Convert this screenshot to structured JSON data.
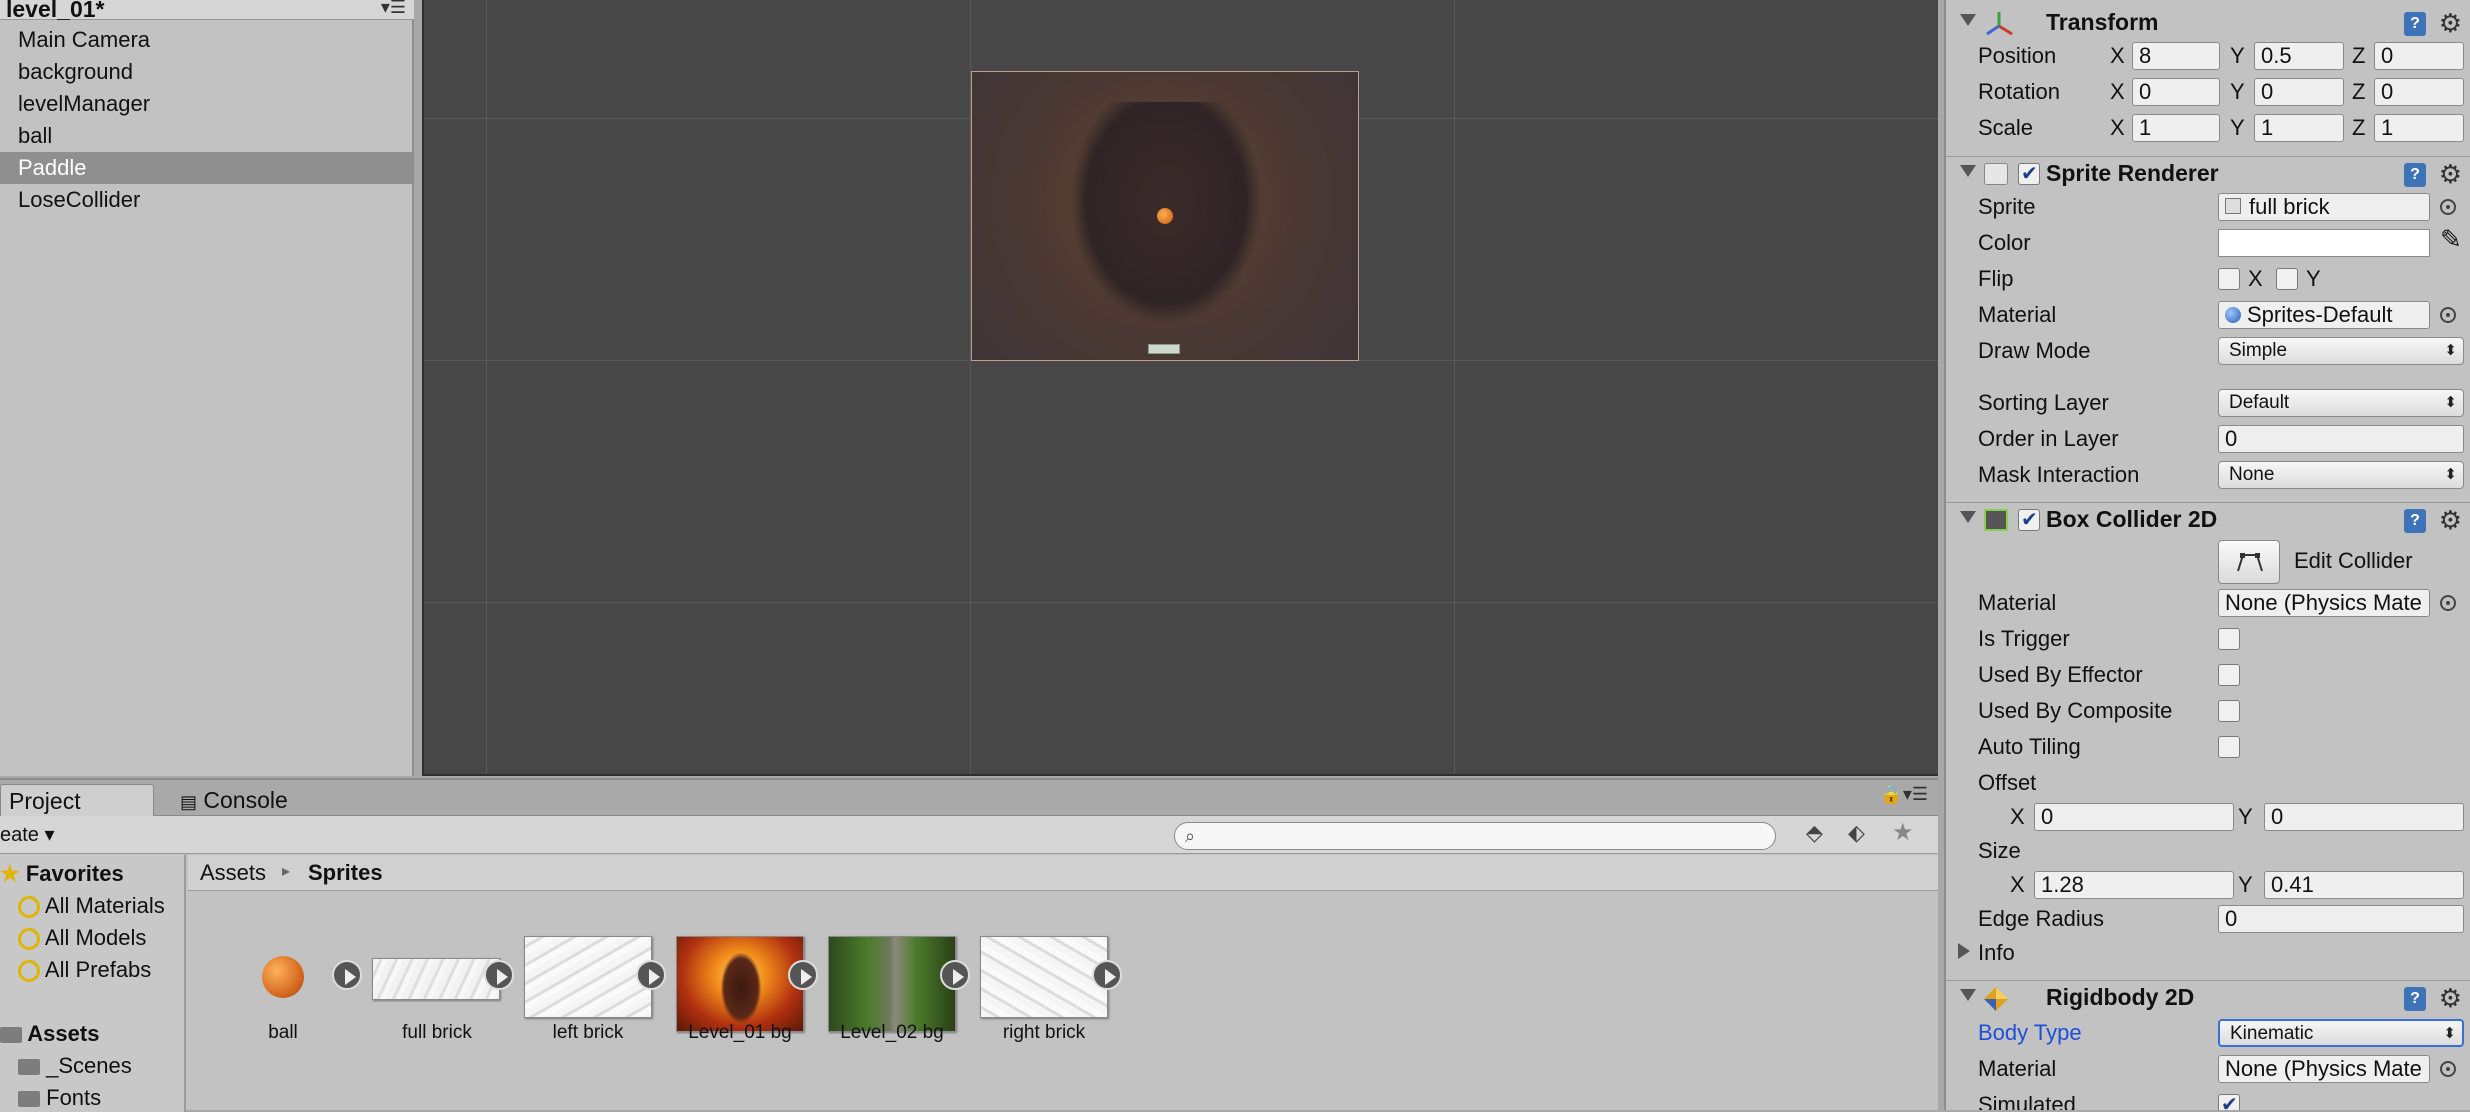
{
  "hierarchy": {
    "scene_name": "level_01*",
    "items": [
      "Main Camera",
      "background",
      "levelManager",
      "ball",
      "Paddle",
      "LoseCollider"
    ],
    "selected": "Paddle"
  },
  "inspector": {
    "transform": {
      "title": "Transform",
      "position_label": "Position",
      "position": {
        "x": "8",
        "y": "0.5",
        "z": "0"
      },
      "rotation_label": "Rotation",
      "rotation": {
        "x": "0",
        "y": "0",
        "z": "0"
      },
      "scale_label": "Scale",
      "scale": {
        "x": "1",
        "y": "1",
        "z": "1"
      },
      "axis_x": "X",
      "axis_y": "Y",
      "axis_z": "Z"
    },
    "sprite_renderer": {
      "title": "Sprite Renderer",
      "sprite_label": "Sprite",
      "sprite_value": "full brick",
      "color_label": "Color",
      "flip_label": "Flip",
      "flip_x": "X",
      "flip_y": "Y",
      "material_label": "Material",
      "material_value": "Sprites-Default",
      "draw_mode_label": "Draw Mode",
      "draw_mode_value": "Simple",
      "sorting_layer_label": "Sorting Layer",
      "sorting_layer_value": "Default",
      "order_label": "Order in Layer",
      "order_value": "0",
      "mask_label": "Mask Interaction",
      "mask_value": "None"
    },
    "box_collider": {
      "title": "Box Collider 2D",
      "edit_collider": "Edit Collider",
      "material_label": "Material",
      "material_value": "None (Physics Mate",
      "is_trigger": "Is Trigger",
      "used_by_effector": "Used By Effector",
      "used_by_composite": "Used By Composite",
      "auto_tiling": "Auto Tiling",
      "offset_label": "Offset",
      "offset": {
        "x": "0",
        "y": "0"
      },
      "size_label": "Size",
      "size": {
        "x": "1.28",
        "y": "0.41"
      },
      "edge_radius_label": "Edge Radius",
      "edge_radius_value": "0",
      "info_label": "Info"
    },
    "rigidbody": {
      "title": "Rigidbody 2D",
      "body_type_label": "Body Type",
      "body_type_value": "Kinematic",
      "material_label": "Material",
      "material_value": "None (Physics Mate",
      "simulated_label": "Simulated"
    }
  },
  "project": {
    "tab_project": "Project",
    "tab_console": "Console",
    "create_label": "eate",
    "favorites_label": "Favorites",
    "favorites": [
      "All Materials",
      "All Models",
      "All Prefabs"
    ],
    "assets_label": "Assets",
    "asset_folders": [
      "_Scenes",
      "Fonts"
    ],
    "breadcrumb": {
      "root": "Assets",
      "sep": "▸",
      "current": "Sprites"
    },
    "assets": [
      "ball",
      "full brick",
      "left brick",
      "Level_01 bg",
      "Level_02 bg",
      "right brick"
    ]
  },
  "colors": {
    "selection": "#8f8f8f",
    "scene_bg": "#474747",
    "help_icon": "#3d73b8",
    "body_type_label": "#1e4fd6"
  }
}
